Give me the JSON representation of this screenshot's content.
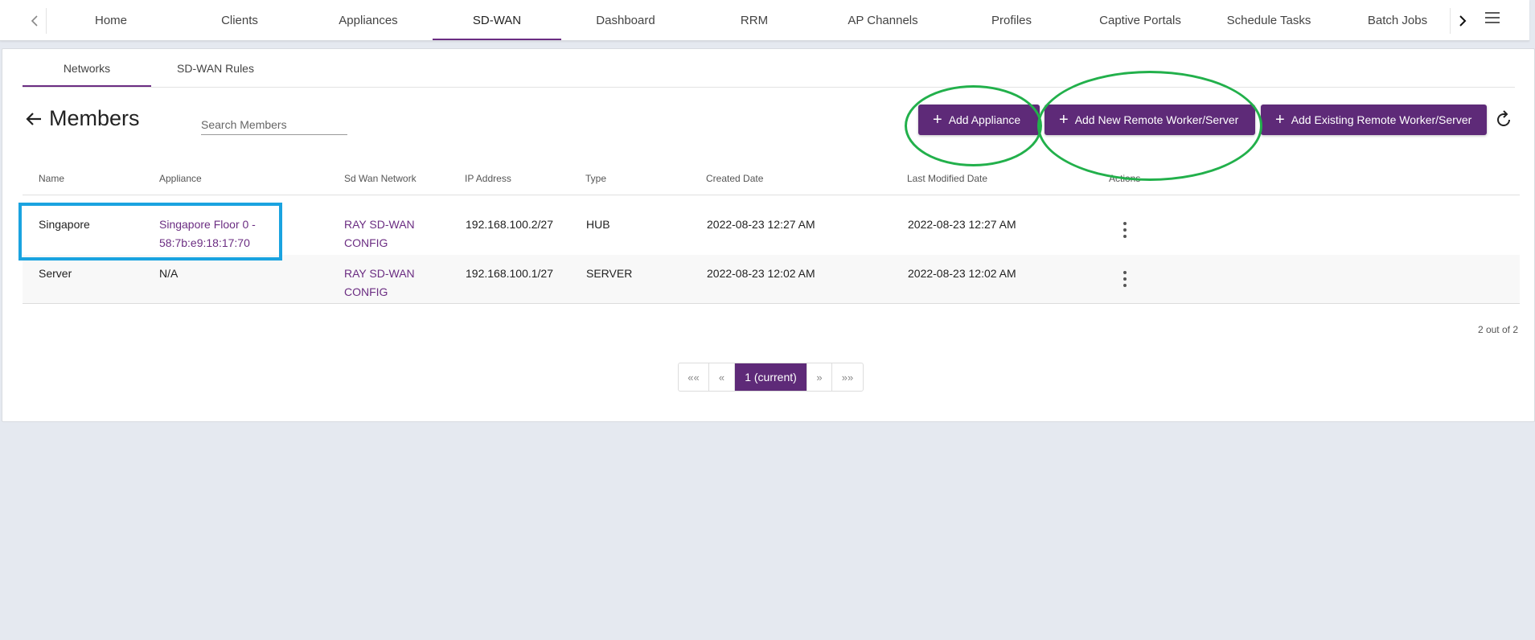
{
  "topnav": {
    "tabs": [
      "Home",
      "Clients",
      "Appliances",
      "SD-WAN",
      "Dashboard",
      "RRM",
      "AP Channels",
      "Profiles",
      "Captive Portals",
      "Schedule Tasks",
      "Batch Jobs"
    ],
    "active_tab": "SD-WAN"
  },
  "subtabs": [
    "Networks",
    "SD-WAN Rules"
  ],
  "page": {
    "title": "Members",
    "search_placeholder": "Search Members"
  },
  "toolbar": {
    "add_appliance": "Add Appliance",
    "add_new_remote": "Add New Remote Worker/Server",
    "add_existing_remote": "Add Existing Remote Worker/Server"
  },
  "table": {
    "headers": [
      "Name",
      "Appliance",
      "Sd Wan Network",
      "IP Address",
      "Type",
      "Created Date",
      "Last Modified Date",
      "Actions"
    ],
    "rows": [
      {
        "name": "Singapore",
        "appliance_line1": "Singapore Floor 0 -",
        "appliance_line2": "58:7b:e9:18:17:70",
        "network_line1": "RAY SD-WAN",
        "network_line2": "CONFIG",
        "ip": "192.168.100.2/27",
        "type": "HUB",
        "created": "2022-08-23 12:27 AM",
        "modified": "2022-08-23 12:27 AM"
      },
      {
        "name": "Server",
        "appliance_line1": "N/A",
        "appliance_line2": "",
        "network_line1": "RAY SD-WAN",
        "network_line2": "CONFIG",
        "ip": "192.168.100.1/27",
        "type": "SERVER",
        "created": "2022-08-23 12:02 AM",
        "modified": "2022-08-23 12:02 AM"
      }
    ]
  },
  "count_text": "2 out of 2",
  "pagination": {
    "first": "««",
    "prev": "«",
    "current": "1 (current)",
    "next": "»",
    "last": "»»"
  },
  "colors": {
    "accent": "#5e2a78",
    "link": "#6b2d82",
    "annotation_blue": "#1aa3e0",
    "annotation_green": "#22b04b"
  }
}
